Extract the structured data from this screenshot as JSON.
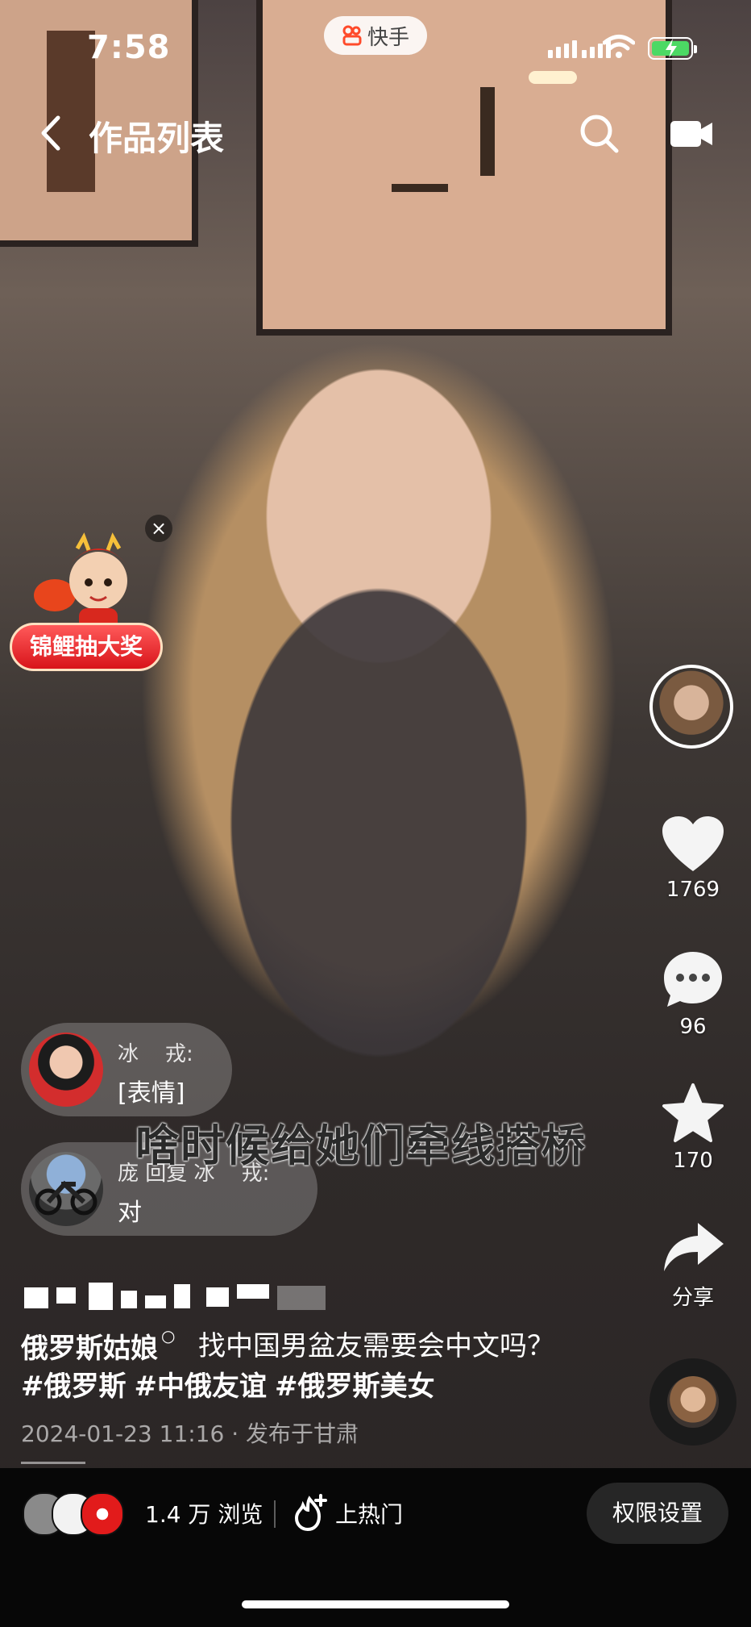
{
  "status_bar": {
    "time": "7:58",
    "app_pill": "快手"
  },
  "nav": {
    "title": "作品列表"
  },
  "promo": {
    "button_label": "锦鲤抽大奖",
    "close_glyph": "×"
  },
  "actions": {
    "like_count": "1769",
    "comment_count": "96",
    "favorite_count": "170",
    "share_label": "分享"
  },
  "comments": [
    {
      "author": "冰    戎:",
      "text": "[表情]"
    },
    {
      "author": "庞 回复 冰    戎:",
      "text": "对"
    }
  ],
  "video": {
    "subtitle": "啥时候给她们牵线搭桥",
    "author_name": "俄罗斯姑娘",
    "description": "找中国男盆友需要会中文吗？",
    "hashtags": [
      "#俄罗斯",
      "#中俄友谊",
      "#俄罗斯美女"
    ],
    "meta": "2024-01-23 11:16 · 发布于甘肃"
  },
  "bottom_bar": {
    "views": "1.4 万 浏览",
    "hot_label": "上热门",
    "permission_button": "权限设置"
  },
  "colors": {
    "accent_red": "#d8141a",
    "battery_green": "#4cd964",
    "kuaishou_orange": "#ff4a2a"
  }
}
